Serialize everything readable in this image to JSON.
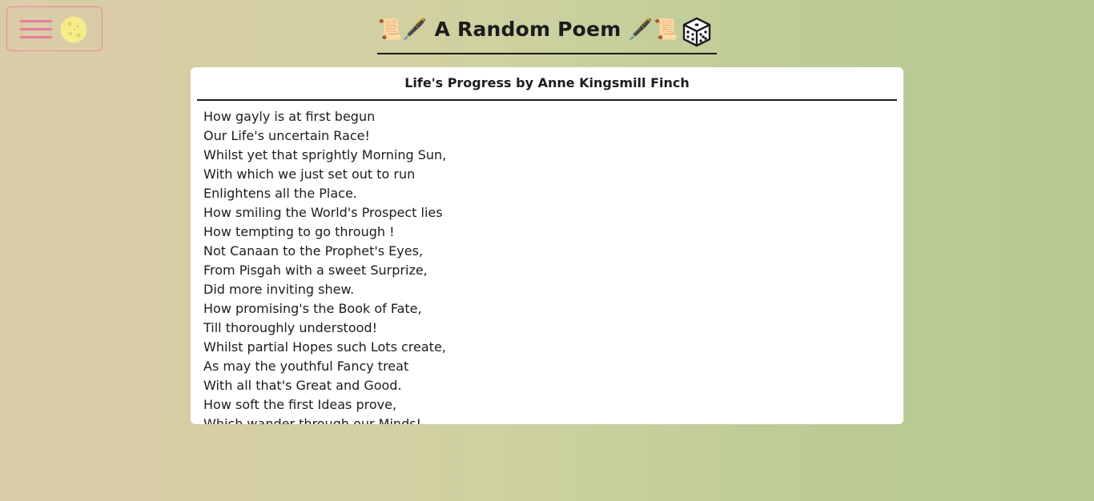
{
  "header": {
    "title": "📜🖋️ A Random Poem 🖋️📜"
  },
  "icons": {
    "menu": "hamburger-menu-icon",
    "theme": "moon-icon",
    "random": "dice-icon"
  },
  "colors": {
    "accent": "#e57e97",
    "moon": "#f5ec8a"
  },
  "poem": {
    "heading": "Life's Progress by Anne Kingsmill Finch",
    "lines": [
      "How gayly is at first begun",
      "Our Life's uncertain Race!",
      "Whilst yet that sprightly Morning Sun,",
      "With which we just set out to run",
      "Enlightens all the Place.",
      "How smiling the World's Prospect lies",
      "How tempting to go through !",
      "Not Canaan to the Prophet's Eyes,",
      "From Pisgah with a sweet Surprize,",
      "Did more inviting shew.",
      "How promising's the Book of Fate,",
      "Till thoroughly understood!",
      "Whilst partial Hopes such Lots create,",
      "As may the youthful Fancy treat",
      "With all that's Great and Good.",
      "How soft the first Ideas prove,",
      "Which wander through our Minds!"
    ]
  }
}
